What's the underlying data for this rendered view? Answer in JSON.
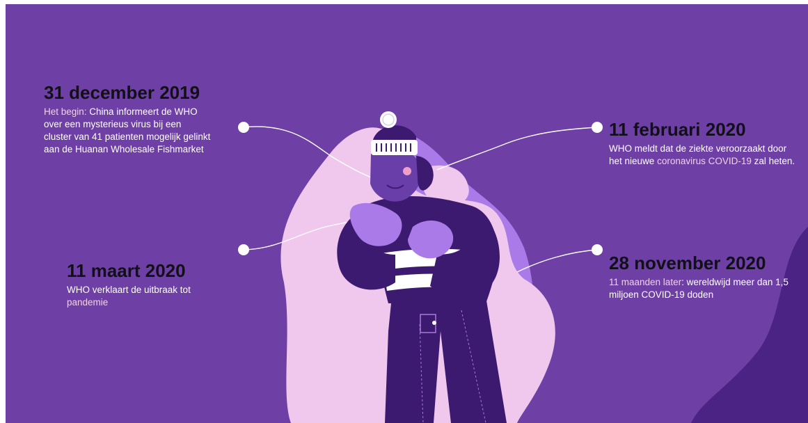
{
  "colors": {
    "background": "#6e40a6",
    "blob_light": "#f0c8ee",
    "blob_mid": "#a97ae8",
    "dark_purple": "#3c1a70",
    "date_text": "#111018",
    "body_text": "#ffffff",
    "highlight_text": "#f4cfe6"
  },
  "events": [
    {
      "date": "31 december 2019",
      "highlight": "Het begin:",
      "text": " China informeert de WHO over een mysterieus virus bij een cluster van 41 patienten mogelijk gelinkt aan de Huanan Wholesale Fishmarket"
    },
    {
      "date": "11 februari 2020",
      "text_before": "WHO meldt dat de ziekte veroorzaakt door het nieuwe ",
      "highlight": "coronavirus COVID-19",
      "text_after": " zal heten."
    },
    {
      "date": "11 maart 2020",
      "text": "WHO verklaart de uitbraak tot ",
      "highlight": "pandemie"
    },
    {
      "date": "28 november 2020",
      "highlight": "11 maanden later",
      "text": ": wereldwijd meer dan 1,5 miljoen COVID-19 doden"
    }
  ],
  "illustration": {
    "subject": "person-with-winter-hat-coughing",
    "icons": [
      "timeline-dot-icon",
      "winter-hat-icon",
      "sick-person-illustration"
    ]
  }
}
